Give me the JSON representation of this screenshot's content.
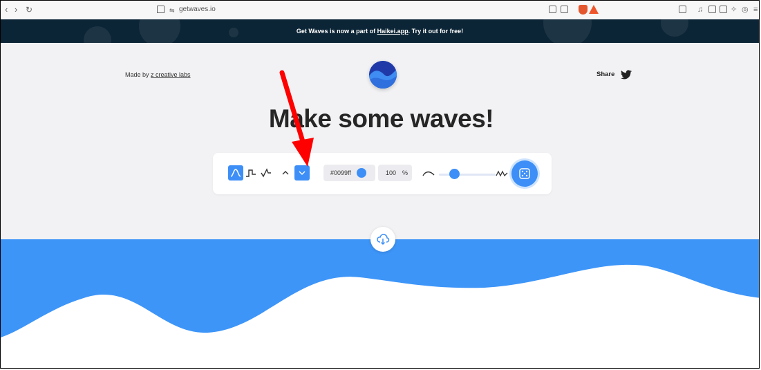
{
  "browser": {
    "url": "getwaves.io"
  },
  "banner": {
    "text_before": "Get Waves is now a part of ",
    "link": "Haikei.app",
    "text_after": ". Try it out for free!"
  },
  "header": {
    "made_by_prefix": "Made by ",
    "made_by_link": "z creative labs",
    "share_label": "Share"
  },
  "hero": {
    "title": "Make some waves!"
  },
  "toolbar": {
    "wave_types": [
      "smooth-wave",
      "step-wave",
      "peak-wave"
    ],
    "selected_wave_type": "smooth-wave",
    "direction_selected": "down",
    "color_value": "#0099ff",
    "opacity_value": "100",
    "opacity_unit": "%",
    "complexity_level": 0.35
  },
  "colors": {
    "accent": "#3d8ff7",
    "banner_bg": "#0c2536",
    "hero_bg": "#f2f2f4",
    "annotation_arrow": "#ff0000"
  }
}
